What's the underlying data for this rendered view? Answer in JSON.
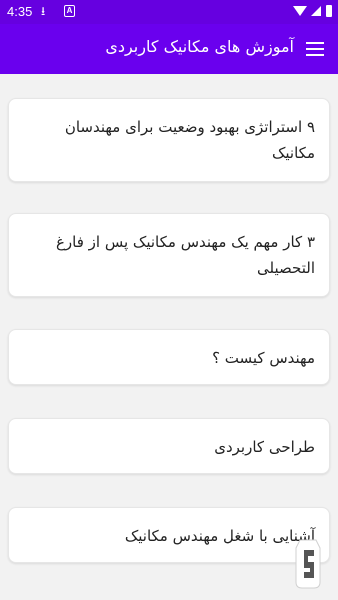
{
  "status_bar": {
    "time": "4:35",
    "icons": [
      "download-icon",
      "app-notification-icon",
      "wifi-icon",
      "signal-icon",
      "battery-icon"
    ]
  },
  "app_bar": {
    "title": "آموزش های مکانیک کاربردی",
    "menu_icon": "hamburger-menu-icon",
    "color": "#6a00ee"
  },
  "items": [
    {
      "label": "۹ استراتژی بهبود وضعیت برای مهندسان مکانیک"
    },
    {
      "label": "۳ کار مهم یک مهندس مکانیک پس از فارغ التحصیلی"
    },
    {
      "label": "مهندس کیست ؟"
    },
    {
      "label": "طراحی کاربردی"
    },
    {
      "label": "آشنایی با شغل مهندس مکانیک"
    }
  ],
  "fab": {
    "icon": "app-logo-icon"
  }
}
